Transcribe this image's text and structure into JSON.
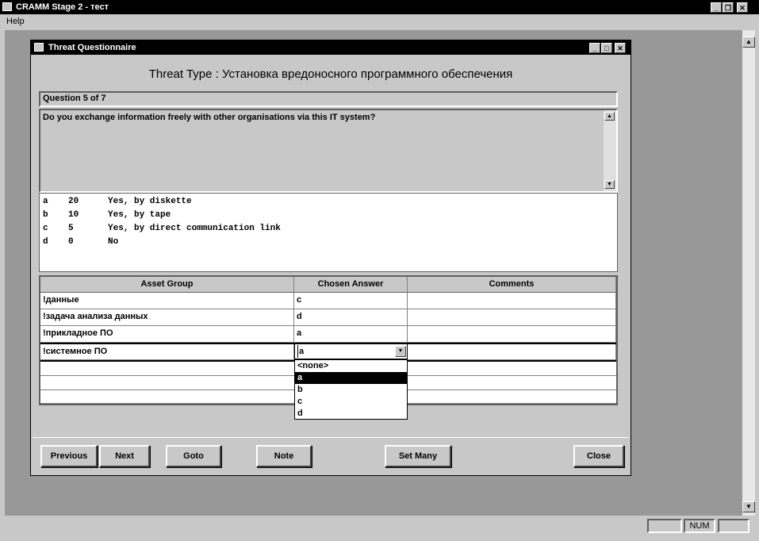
{
  "app": {
    "title": "CRAMM Stage 2 - тест",
    "menu": [
      "Help"
    ]
  },
  "dialog": {
    "title": "Threat Questionnaire",
    "threat_type": "Threat Type : Установка вредоносного программного обеспечения",
    "question_counter": "Question 5 of 7",
    "question_text": "Do you exchange information freely with other organisations via this IT system?",
    "answers": [
      {
        "key": "a",
        "score": "20",
        "text": "Yes, by diskette"
      },
      {
        "key": "b",
        "score": "10",
        "text": "Yes, by tape"
      },
      {
        "key": "c",
        "score": "5",
        "text": "Yes, by direct communication link"
      },
      {
        "key": "d",
        "score": "0",
        "text": "No"
      }
    ],
    "grid": {
      "columns": [
        "Asset Group",
        "Chosen Answer",
        "Comments"
      ],
      "rows": [
        {
          "asset": "!данные",
          "answer": "c",
          "comment": ""
        },
        {
          "asset": "!задача анализа данных",
          "answer": "d",
          "comment": ""
        },
        {
          "asset": "!прикладное ПО",
          "answer": "a",
          "comment": ""
        },
        {
          "asset": "!системное ПО",
          "answer": "a",
          "comment": ""
        }
      ]
    },
    "dropdown": {
      "selected": "a",
      "options": [
        "<none>",
        "a",
        "b",
        "c",
        "d"
      ]
    },
    "buttons": {
      "previous": "Previous",
      "next": "Next",
      "goto": "Goto",
      "note": "Note",
      "set_many": "Set Many",
      "close": "Close"
    }
  },
  "statusbar": {
    "num": "NUM"
  }
}
